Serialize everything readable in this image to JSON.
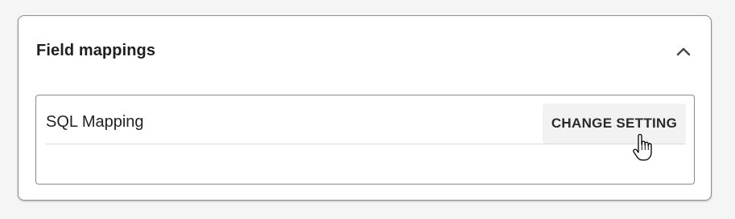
{
  "panel": {
    "title": "Field mappings",
    "collapse_icon": "chevron-up-icon"
  },
  "mapping": {
    "label": "SQL Mapping",
    "button_label": "CHANGE SETTING"
  },
  "cursor": {
    "icon": "hand-pointer-icon"
  }
}
